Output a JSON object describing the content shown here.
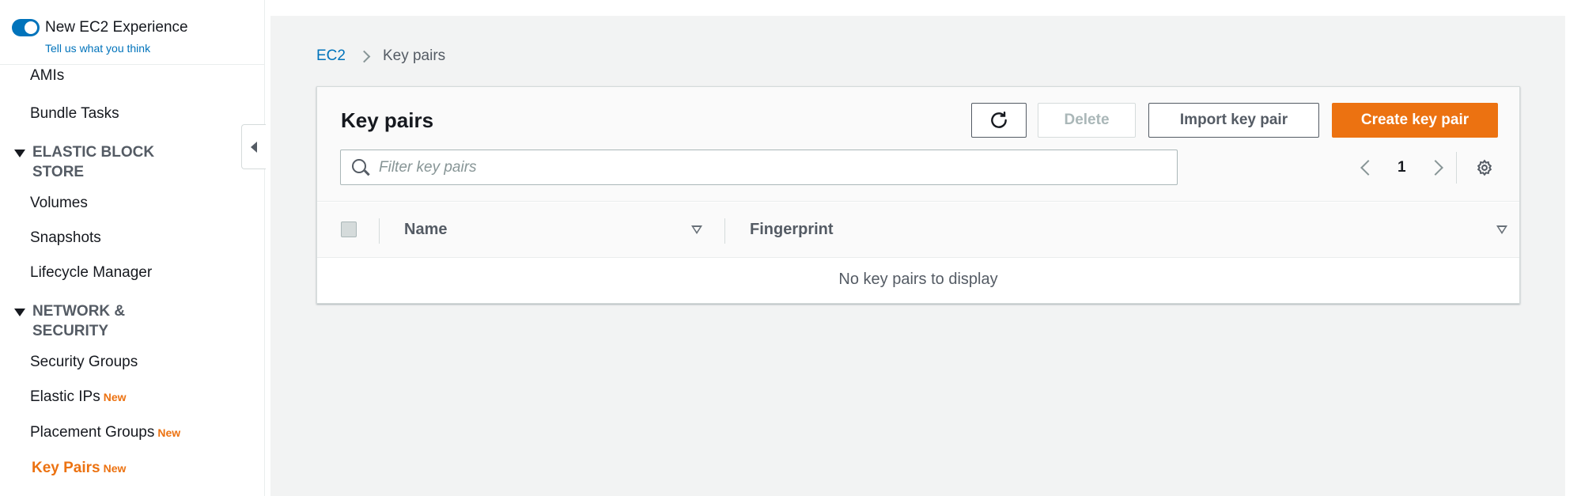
{
  "experience": {
    "title": "New EC2 Experience",
    "feedback_link": "Tell us what you think",
    "enabled": true
  },
  "sidebar": {
    "items_top": [
      {
        "label": "AMIs"
      },
      {
        "label": "Bundle Tasks"
      }
    ],
    "sections": [
      {
        "title_line1": "ELASTIC BLOCK",
        "title_line2": "STORE",
        "items": [
          {
            "label": "Volumes"
          },
          {
            "label": "Snapshots"
          },
          {
            "label": "Lifecycle Manager"
          }
        ]
      },
      {
        "title_line1": "NETWORK &",
        "title_line2": "SECURITY",
        "items": [
          {
            "label": "Security Groups",
            "badge": ""
          },
          {
            "label": "Elastic IPs",
            "badge": "New"
          },
          {
            "label": "Placement Groups",
            "badge": "New"
          },
          {
            "label": "Key Pairs",
            "badge": "New",
            "active": true
          }
        ]
      }
    ]
  },
  "breadcrumb": {
    "root": "EC2",
    "current": "Key pairs"
  },
  "panel": {
    "title": "Key pairs",
    "buttons": {
      "delete": "Delete",
      "import": "Import key pair",
      "create": "Create key pair"
    },
    "search_placeholder": "Filter key pairs",
    "search_value": "",
    "page": "1",
    "columns": [
      "Name",
      "Fingerprint"
    ],
    "empty_message": "No key pairs to display"
  },
  "colors": {
    "accent": "#ec7211",
    "link": "#0073bb",
    "toggle": "#0073bb"
  }
}
